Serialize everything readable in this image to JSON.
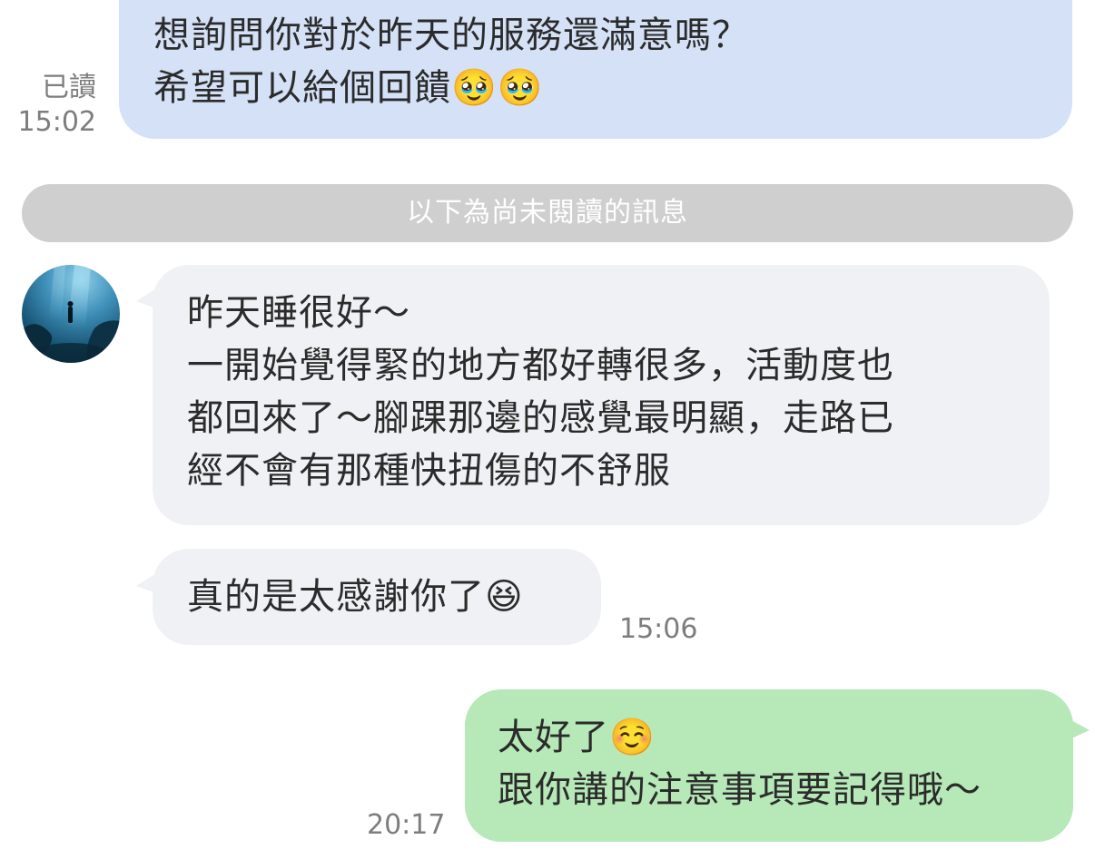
{
  "messages": {
    "m1": {
      "line1": "想詢問你對於昨天的服務還滿意嗎？",
      "line2": "希望可以給個回饋🥹🥹",
      "read_label": "已讀",
      "time": "15:02"
    },
    "divider": "以下為尚未閱讀的訊息",
    "m2": {
      "line1": "昨天睡很好～",
      "line2": "一開始覺得緊的地方都好轉很多，活動度也",
      "line3": "都回來了～腳踝那邊的感覺最明顯，走路已",
      "line4": "經不會有那種快扭傷的不舒服"
    },
    "m3": {
      "text": "真的是太感謝你了😆",
      "time": "15:06"
    },
    "m4": {
      "line1": "太好了☺️",
      "line2": "跟你講的注意事項要記得哦～",
      "time": "20:17"
    }
  },
  "colors": {
    "outgoing_blue": "#d5e1f6",
    "incoming_gray": "#f0f1f4",
    "outgoing_green": "#b6e8b8",
    "divider": "#cfcfcf",
    "meta_text": "#7d7d7d"
  },
  "icons": {
    "avatar": "contact-avatar-underwater-photo"
  }
}
